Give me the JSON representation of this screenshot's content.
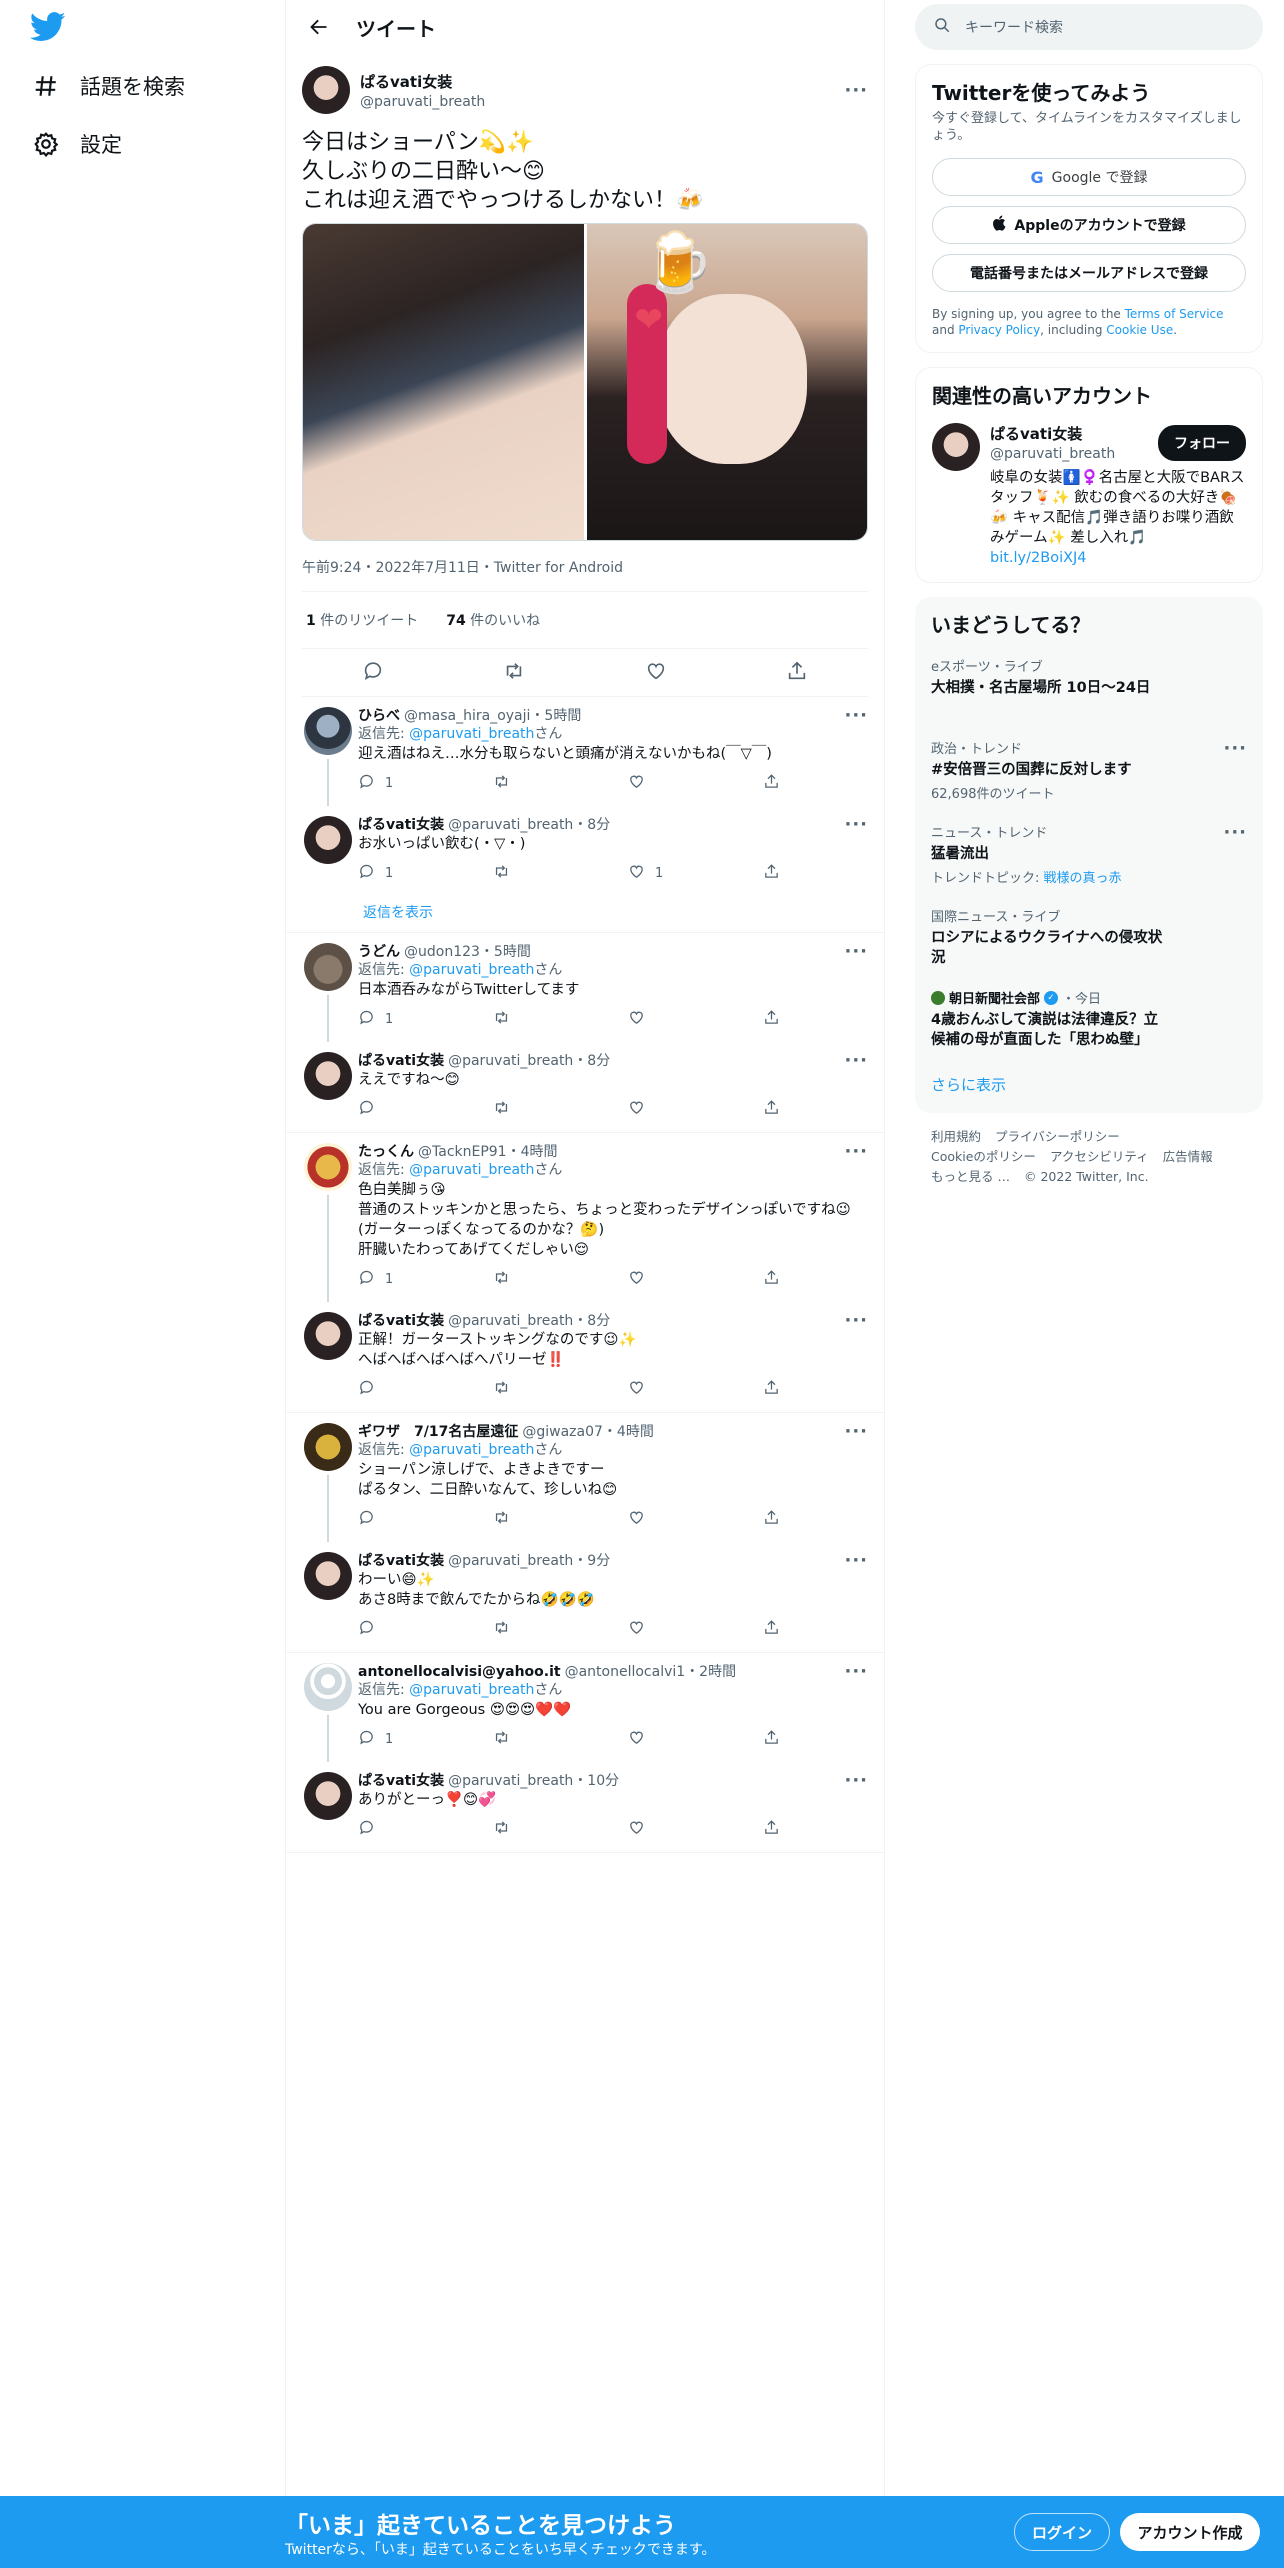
{
  "nav": {
    "explore_label": "話題を検索",
    "settings_label": "設定"
  },
  "header": {
    "title": "ツイート"
  },
  "main_tweet": {
    "name": "ぱるvati女装",
    "handle": "@paruvati_breath",
    "text": "今日はショーパン💫✨\n久しぶりの二日酔い〜😊\nこれは迎え酒でやっつけるしかない！🍻",
    "timestamp": "午前9:24・2022年7月11日・Twitter for Android",
    "retweets": "1",
    "retweets_label": "件のリツイート",
    "likes": "74",
    "likes_label": "件のいいね"
  },
  "threads": [
    {
      "replies": [
        {
          "name": "ひらべ",
          "handle": "@masa_hira_oyaji",
          "time": "・5時間",
          "reply_to": "@paruvati_breath",
          "reply_prefix": "返信先: ",
          "reply_suffix": "さん",
          "text": "迎え酒はねえ…水分も取らないと頭痛が消えないかもね(￣▽￣)",
          "replies": "1",
          "retweets": "",
          "likes": ""
        },
        {
          "name": "ぱるvati女装",
          "handle": "@paruvati_breath",
          "time": "・8分",
          "text": "お水いっぱい飲む(・▽・)",
          "replies": "1",
          "retweets": "",
          "likes": "1"
        }
      ],
      "show_replies": "返信を表示"
    },
    {
      "replies": [
        {
          "name": "うどん",
          "handle": "@udon123",
          "time": "・5時間",
          "reply_to": "@paruvati_breath",
          "reply_prefix": "返信先: ",
          "reply_suffix": "さん",
          "text": "日本酒呑みながらTwitterしてます",
          "replies": "1",
          "retweets": "",
          "likes": ""
        },
        {
          "name": "ぱるvati女装",
          "handle": "@paruvati_breath",
          "time": "・8分",
          "text": "ええですね〜😊",
          "replies": "",
          "retweets": "",
          "likes": ""
        }
      ]
    },
    {
      "replies": [
        {
          "name": "たっくん",
          "handle": "@TacknEP91",
          "time": "・4時間",
          "reply_to": "@paruvati_breath",
          "reply_prefix": "返信先: ",
          "reply_suffix": "さん",
          "text": "色白美脚ぅ😘\n普通のストッキンかと思ったら、ちょっと変わったデザインっぽいですね😉(ガーターっぽくなってるのかな？🤔)\n肝臓いたわってあげてくだしゃい😌",
          "replies": "1",
          "retweets": "",
          "likes": ""
        },
        {
          "name": "ぱるvati女装",
          "handle": "@paruvati_breath",
          "time": "・8分",
          "text": "正解！ガーターストッキングなのです😉✨\nへばへばへばへばへパリーゼ‼️",
          "replies": "",
          "retweets": "",
          "likes": ""
        }
      ]
    },
    {
      "replies": [
        {
          "name": "ギワザ　7/17名古屋遠征",
          "handle": "@giwaza07",
          "time": "・4時間",
          "reply_to": "@paruvati_breath",
          "reply_prefix": "返信先: ",
          "reply_suffix": "さん",
          "text": "ショーパン涼しげで、よきよきですー\nぱるタン、二日酔いなんて、珍しいね😊",
          "replies": "",
          "retweets": "",
          "likes": ""
        },
        {
          "name": "ぱるvati女装",
          "handle": "@paruvati_breath",
          "time": "・9分",
          "text": "わーい😄✨\nあさ8時まで飲んでたからね🤣🤣🤣",
          "replies": "",
          "retweets": "",
          "likes": ""
        }
      ]
    },
    {
      "replies": [
        {
          "name": "antonellocalvisi@yahoo.it",
          "handle": "@antonellocalvi1",
          "time": "・2時間",
          "reply_to": "@paruvati_breath",
          "reply_prefix": "返信先: ",
          "reply_suffix": "さん",
          "text": "You are Gorgeous 😍😍😍❤️❤️",
          "replies": "1",
          "retweets": "",
          "likes": ""
        },
        {
          "name": "ぱるvati女装",
          "handle": "@paruvati_breath",
          "time": "・10分",
          "text": "ありがとーっ❣️😊💞",
          "replies": "",
          "retweets": "",
          "likes": ""
        }
      ]
    }
  ],
  "search": {
    "placeholder": "キーワード検索"
  },
  "signup": {
    "title": "Twitterを使ってみよう",
    "subtitle": "今すぐ登録して、タイムラインをカスタマイズしましょう。",
    "google": "Google で登録",
    "apple": "Appleのアカウントで登録",
    "phone": "電話番号またはメールアドレスで登録",
    "legal_prefix": "By signing up, you agree to the ",
    "terms": "Terms of Service",
    "legal_and": " and ",
    "privacy": "Privacy Policy",
    "legal_incl": ", including ",
    "cookie": "Cookie Use",
    "legal_end": "."
  },
  "related": {
    "title": "関連性の高いアカウント",
    "name": "ぱるvati女装",
    "handle": "@paruvati_breath",
    "follow": "フォロー",
    "bio": "岐阜の女装🚺♀️名古屋と大阪でBARスタッフ🍹✨ 飲むの食べるの大好き🍖🍻 キャス配信🎵弾き語りお喋り酒飲みゲーム✨ 差し入れ🎵",
    "link": "bit.ly/2BoiXJ4"
  },
  "trends": {
    "title": "いまどうしてる？",
    "items": [
      {
        "context": "eスポーツ・ライブ",
        "title": "大相撲・名古屋場所 10日〜24日",
        "count": ""
      },
      {
        "context": "政治・トレンド",
        "title": "#安倍晋三の国葬に反対します",
        "count": "62,698件のツイート"
      },
      {
        "context": "ニュース・トレンド",
        "title": "猛暑流出",
        "count_prefix": "トレンドトピック: ",
        "count_link": "戦様の真っ赤"
      },
      {
        "context": "国際ニュース・ライブ",
        "title": "ロシアによるウクライナへの侵攻状況",
        "count": ""
      },
      {
        "context_name": "朝日新聞社会部",
        "context_time": "・今日",
        "title": "4歳おんぶして演説は法律違反？立候補の母が直面した「思わぬ壁」"
      }
    ],
    "show_more": "さらに表示"
  },
  "footer": {
    "terms": "利用規約",
    "privacy": "プライバシーポリシー",
    "cookie": "Cookieのポリシー",
    "access": "アクセシビリティ",
    "ads": "広告情報",
    "more": "もっと見る …",
    "copyright": "© 2022 Twitter, Inc."
  },
  "bottom_bar": {
    "title": "「いま」起きていることを見つけよう",
    "subtitle": "Twitterなら、「いま」起きていることをいち早くチェックできます。",
    "login": "ログイン",
    "signup": "アカウント作成"
  },
  "colors": {
    "accent": "#1d9bf0",
    "text": "#0f1419",
    "muted": "#536471"
  }
}
